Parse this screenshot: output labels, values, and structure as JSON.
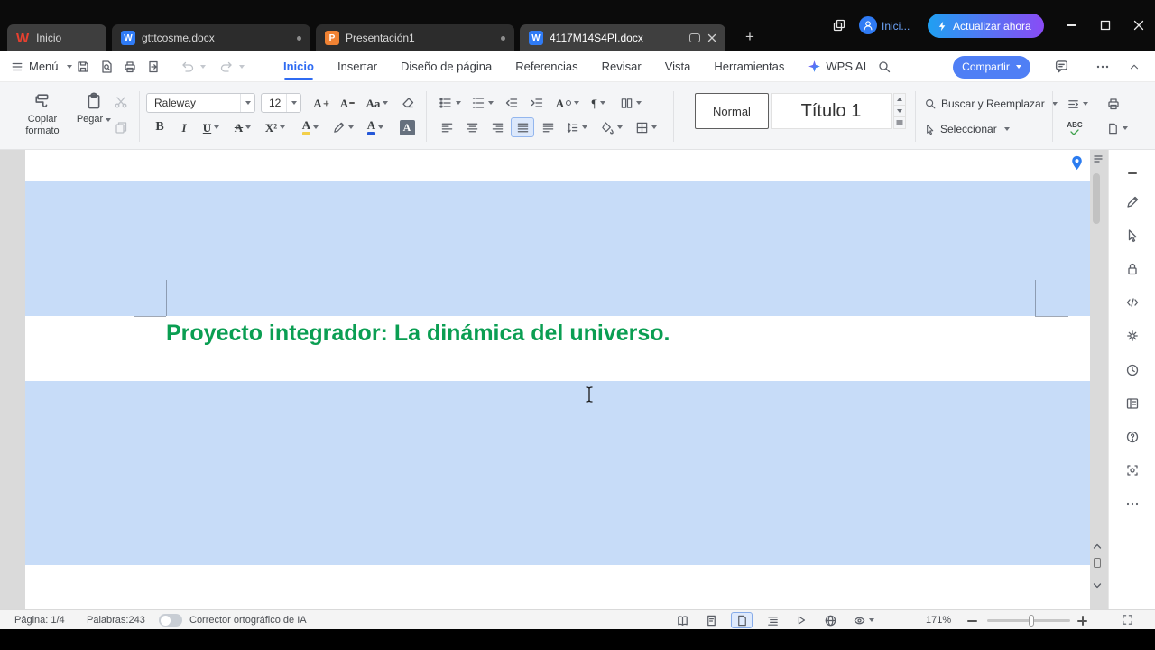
{
  "tabbar": {
    "home_label": "Inicio",
    "wps_logo": "W",
    "writer_badge": "W",
    "presentation_badge": "P",
    "tabs": [
      {
        "label": "gtttcosme.docx"
      },
      {
        "label": "Presentación1"
      },
      {
        "label": "4117M14S4PI.docx"
      }
    ],
    "new_tab_glyph": "+",
    "login_label": "Inici...",
    "update_button": "Actualizar ahora"
  },
  "menubar": {
    "menu_label": "Menú",
    "items": [
      {
        "label": "Inicio"
      },
      {
        "label": "Insertar"
      },
      {
        "label": "Diseño de página"
      },
      {
        "label": "Referencias"
      },
      {
        "label": "Revisar"
      },
      {
        "label": "Vista"
      },
      {
        "label": "Herramientas"
      },
      {
        "label": "WPS AI"
      }
    ],
    "share_button": "Compartir"
  },
  "ribbon": {
    "format_painter_label": "Copiar formato",
    "paste_label": "Pegar",
    "font_name": "Raleway",
    "font_size": "12",
    "glyphs": {
      "bold": "B",
      "italic": "I",
      "underline": "U",
      "strikethrough": "A",
      "superscript": "X²",
      "change_case": "Aa",
      "grow_font": "A",
      "shrink_font": "A",
      "highlight": "A",
      "font_color": "A",
      "char_shading": "A",
      "asian_layout": "A",
      "pilcrow": "¶",
      "spell_abc": "ABC"
    },
    "style_normal": "Normal",
    "style_title1": "Título 1",
    "find_replace_label": "Buscar y Reemplazar",
    "select_label": "Seleccionar"
  },
  "document": {
    "heading": "Proyecto integrador: La dinámica del universo."
  },
  "statusbar": {
    "page_label": "Página: 1/4",
    "words_label": "Palabras:243",
    "spellcheck_label": "Corrector ortográfico de IA",
    "zoom_value": "171%"
  },
  "colors": {
    "accent_blue": "#2f6bf2",
    "heading_green": "#0a9e52",
    "selection_blue": "#c7dcf8",
    "update_gradient_start": "#1fa0f2",
    "update_gradient_end": "#8a4bf5"
  }
}
